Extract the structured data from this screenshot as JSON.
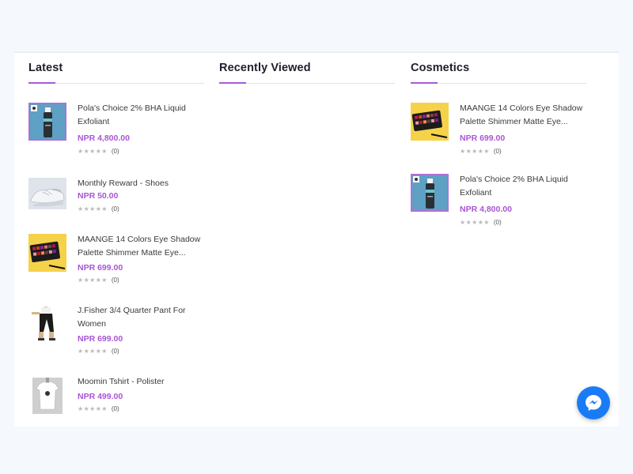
{
  "columns": {
    "latest": {
      "title": "Latest",
      "products": [
        {
          "name": "Pola's Choice 2% BHA Liquid Exfoliant",
          "price": "NPR 4,800.00",
          "rating_stars": "★★★★★",
          "review_count": "(0)",
          "image": "serum-bottle-icon"
        },
        {
          "name": "Monthly Reward - Shoes",
          "price": "NPR 50.00",
          "rating_stars": "★★★★★",
          "review_count": "(0)",
          "image": "sneakers-icon"
        },
        {
          "name": "MAANGE 14 Colors Eye Shadow Palette Shimmer Matte Eye...",
          "price": "NPR 699.00",
          "rating_stars": "★★★★★",
          "review_count": "(0)",
          "image": "eyeshadow-palette-icon"
        },
        {
          "name": "J.Fisher 3/4 Quarter Pant For Women",
          "price": "NPR 699.00",
          "rating_stars": "★★★★★",
          "review_count": "(0)",
          "image": "pants-icon"
        },
        {
          "name": "Moomin Tshirt - Polister",
          "price": "NPR 499.00",
          "rating_stars": "★★★★★",
          "review_count": "(0)",
          "image": "tshirt-icon"
        }
      ]
    },
    "recently_viewed": {
      "title": "Recently Viewed"
    },
    "cosmetics": {
      "title": "Cosmetics",
      "products": [
        {
          "name": "MAANGE 14 Colors Eye Shadow Palette Shimmer Matte Eye...",
          "price": "NPR 699.00",
          "rating_stars": "★★★★★",
          "review_count": "(0)",
          "image": "eyeshadow-palette-icon"
        },
        {
          "name": "Pola's Choice 2% BHA Liquid Exfoliant",
          "price": "NPR 4,800.00",
          "rating_stars": "★★★★★",
          "review_count": "(0)",
          "image": "serum-bottle-icon"
        }
      ]
    }
  },
  "chat_widget": {
    "icon": "messenger-icon"
  },
  "colors": {
    "accent": "#a85ad8",
    "price": "#a855d6",
    "messenger": "#1a7cf5",
    "page_bg": "#f5f8fd"
  }
}
